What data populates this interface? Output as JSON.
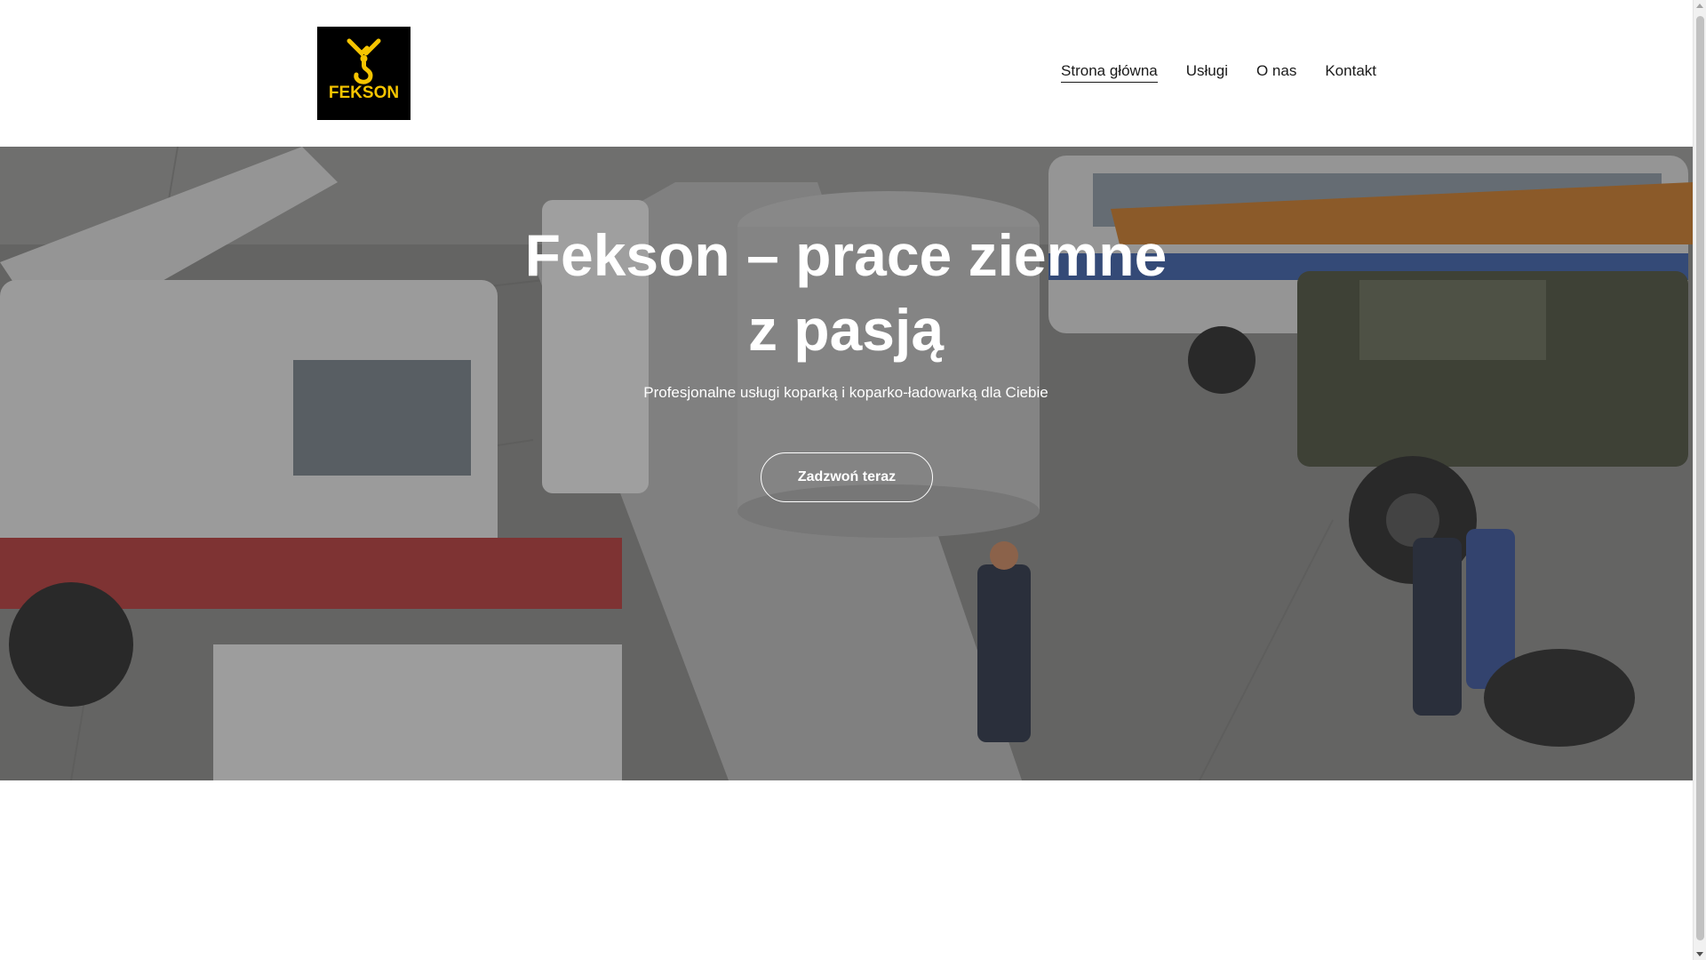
{
  "header": {
    "logo": {
      "icon": "crane-hook-icon",
      "text": "FEKSON",
      "bg_color": "#000000",
      "accent_color": "#f5c400"
    },
    "nav": [
      {
        "label": "Strona główna",
        "active": true
      },
      {
        "label": "Usługi",
        "active": false
      },
      {
        "label": "O nas",
        "active": false
      },
      {
        "label": "Kontakt",
        "active": false
      }
    ]
  },
  "hero": {
    "title_line1": "Fekson – prace ziemne",
    "title_line2": "z pasją",
    "subtitle": "Profesjonalne usługi koparką i koparko-ładowarką dla Ciebie",
    "cta_label": "Zadzwoń teraz",
    "background_image": "cranes-and-trucks-photo"
  },
  "colors": {
    "text": "#1a1a1a",
    "hero_text": "#ffffff",
    "page_bg": "#ffffff"
  }
}
